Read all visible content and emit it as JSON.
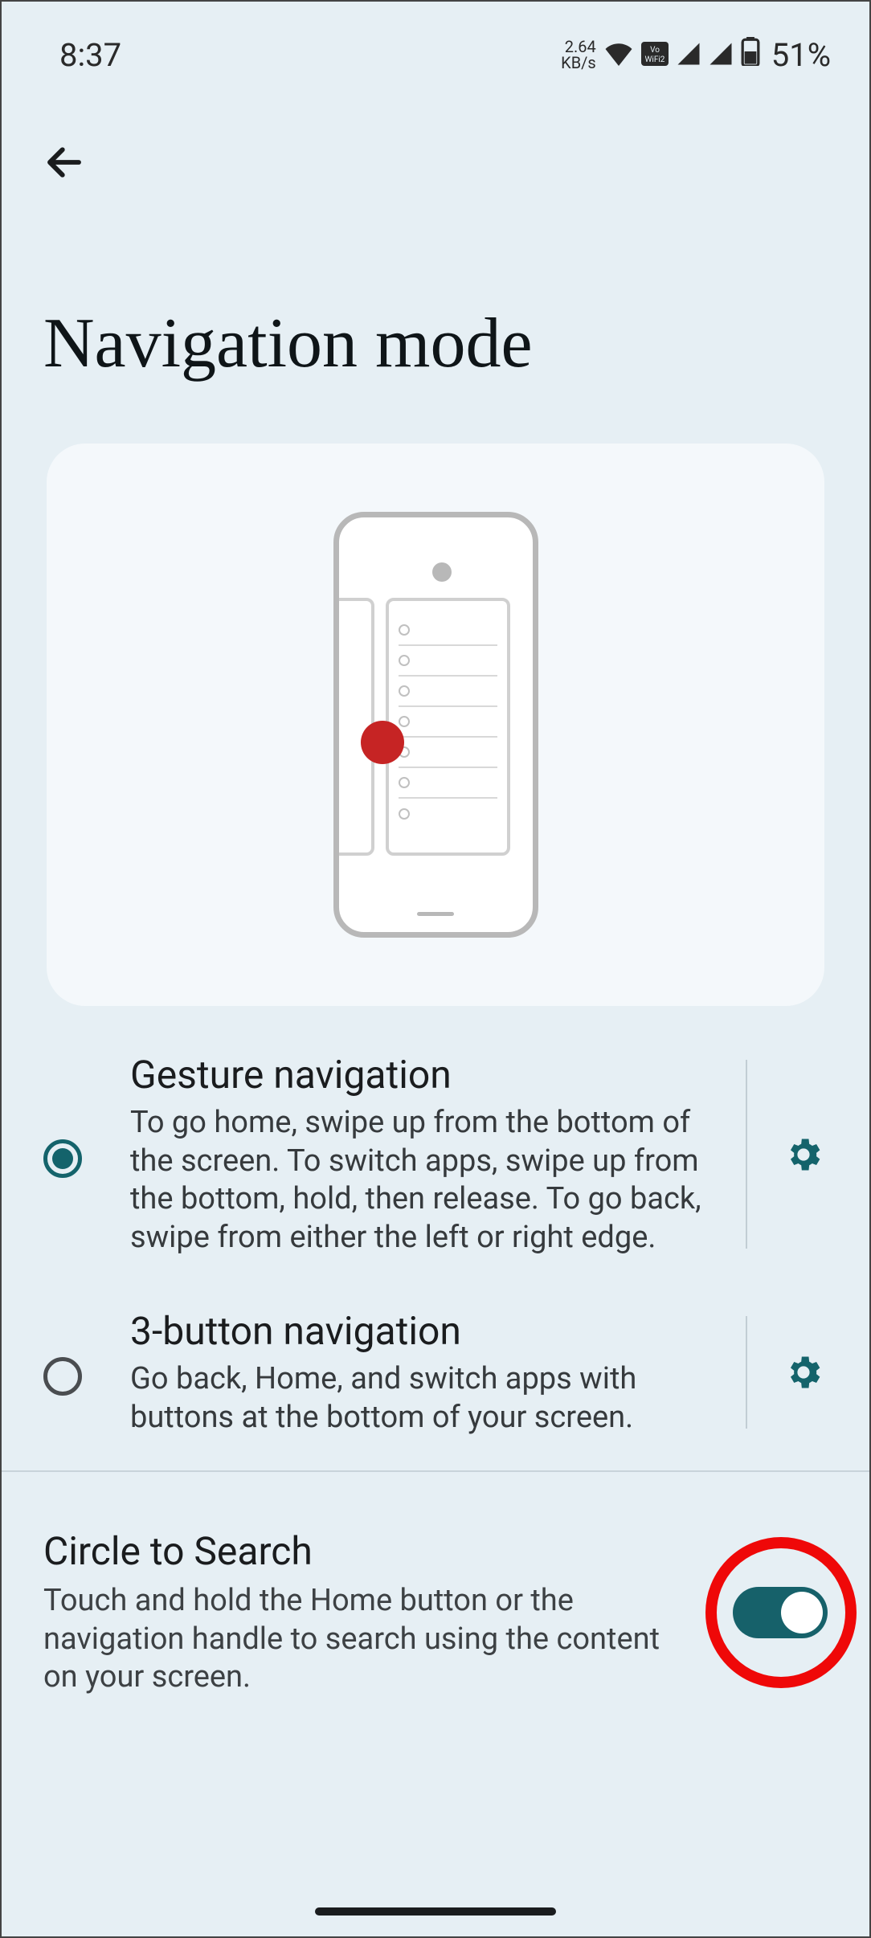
{
  "status": {
    "time": "8:37",
    "net_rate": "2.64",
    "net_unit": "KB/s",
    "battery_pct": "51%"
  },
  "header": {
    "title": "Navigation mode"
  },
  "options": {
    "gesture": {
      "title": "Gesture navigation",
      "desc": "To go home, swipe up from the bottom of the screen. To switch apps, swipe up from the bottom, hold, then release. To go back, swipe from either the left or right edge.",
      "selected": true
    },
    "threebtn": {
      "title": "3-button navigation",
      "desc": "Go back, Home, and switch apps with buttons at the bottom of your screen.",
      "selected": false
    }
  },
  "circle_to_search": {
    "title": "Circle to Search",
    "desc": "Touch and hold the Home button or the navigation handle to search using the content on your screen.",
    "enabled": true
  },
  "colors": {
    "accent": "#14636b",
    "highlight": "#ef0808",
    "touch_dot": "#c62424"
  }
}
